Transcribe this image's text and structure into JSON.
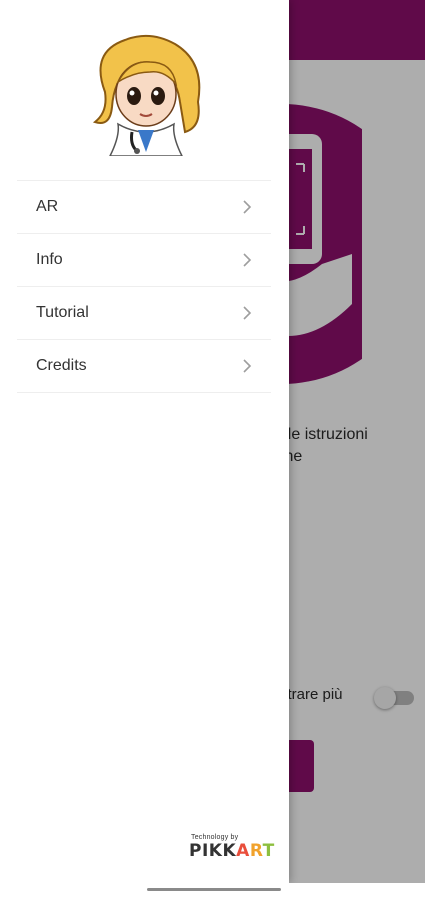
{
  "background": {
    "instruction_partial": "gui le istruzioni",
    "instruction_partial_2": "ione",
    "toggle_label_partial": "strare più",
    "toggle_on": false
  },
  "drawer": {
    "menu": [
      {
        "label": "AR"
      },
      {
        "label": "Info"
      },
      {
        "label": "Tutorial"
      },
      {
        "label": "Credits"
      }
    ],
    "footer": {
      "by": "Technology by",
      "brand": "PIKKART"
    }
  },
  "colors": {
    "brand_primary": "#8e0f6c",
    "brand_logo": [
      "#333333",
      "#e94e3b",
      "#f1a22c",
      "#8dbf3f"
    ]
  }
}
